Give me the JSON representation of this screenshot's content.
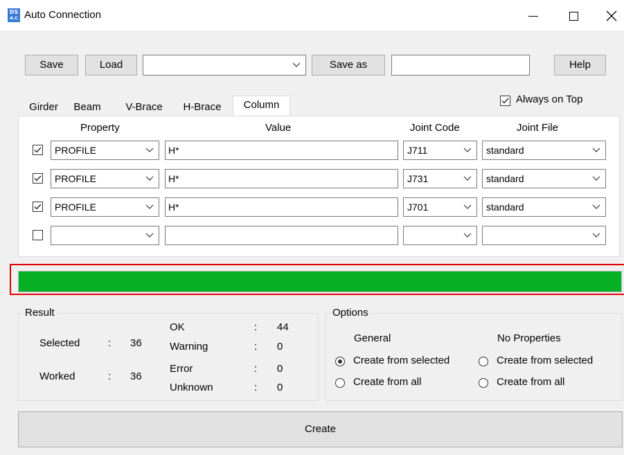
{
  "window": {
    "title": "Auto Connection",
    "icon_text_top": "DS",
    "icon_text_bottom": "A.C"
  },
  "toolbar": {
    "save_label": "Save",
    "load_label": "Load",
    "preset_value": "",
    "save_as_label": "Save as",
    "save_as_value": "",
    "help_label": "Help"
  },
  "always_on_top": {
    "label": "Always on Top",
    "checked": true
  },
  "tabs": [
    {
      "label": "Girder",
      "active": false
    },
    {
      "label": "Beam",
      "active": false
    },
    {
      "label": "V-Brace",
      "active": false
    },
    {
      "label": "H-Brace",
      "active": false
    },
    {
      "label": "Column",
      "active": true
    }
  ],
  "table": {
    "headers": {
      "property": "Property",
      "value": "Value",
      "joint_code": "Joint Code",
      "joint_file": "Joint File"
    },
    "rows": [
      {
        "checked": true,
        "property": "PROFILE",
        "value": "H*",
        "joint_code": "J711",
        "joint_file": "standard"
      },
      {
        "checked": true,
        "property": "PROFILE",
        "value": "H*",
        "joint_code": "J731",
        "joint_file": "standard"
      },
      {
        "checked": true,
        "property": "PROFILE",
        "value": "H*",
        "joint_code": "J701",
        "joint_file": "standard"
      },
      {
        "checked": false,
        "property": "",
        "value": "",
        "joint_code": "",
        "joint_file": ""
      }
    ]
  },
  "progress": {
    "fraction": 1.0,
    "color": "#06b025"
  },
  "result": {
    "title": "Result",
    "selected_label": "Selected",
    "selected_value": "36",
    "worked_label": "Worked",
    "worked_value": "36",
    "ok_label": "OK",
    "ok_value": "44",
    "warning_label": "Warning",
    "warning_value": "0",
    "error_label": "Error",
    "error_value": "0",
    "unknown_label": "Unknown",
    "unknown_value": "0",
    "colon": ":"
  },
  "options": {
    "title": "Options",
    "general_title": "General",
    "no_properties_title": "No Properties",
    "general_from_selected": "Create from selected",
    "general_from_all": "Create from all",
    "noprop_from_selected": "Create from selected",
    "noprop_from_all": "Create from all"
  },
  "create_label": "Create"
}
